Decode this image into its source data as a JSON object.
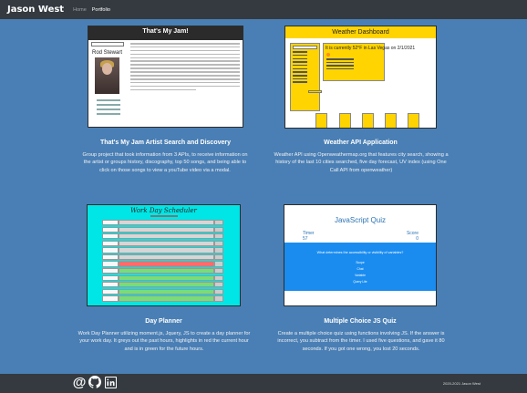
{
  "navbar": {
    "brand": "Jason West",
    "links": [
      "Home",
      "Portfolio"
    ]
  },
  "projects": [
    {
      "title": "That's My Jam Artist Search and Discovery",
      "description": "Group project that took information from 3 APIs, to receive information on the artist or groups history, discography, top 50 songs, and being able to click on those songs to view a youTube video via a modal.",
      "screenshot": {
        "header": "That's My Jam!",
        "artist_name": "Rod Stewart"
      }
    },
    {
      "title": "Weather API Application",
      "description": "Weather API using Openweathermap.org that features city search, showing a history of the last 10 cities searched, five day forecast, UV index (using One Call API from openweather)",
      "screenshot": {
        "header": "Weather Dashboard",
        "current": "It is currently 52°F in Las Vegas on 2/1/2021"
      }
    },
    {
      "title": "Day Planner",
      "description": "Work Day Planner utilizing moment.js, Jquery, JS to create a day planner for your work day. It greys out the past hours, highlights in red the current hour and is in green for the future hours.",
      "screenshot": {
        "header": "Work Day Scheduler"
      }
    },
    {
      "title": "Multiple Choice JS Quiz",
      "description": "Create a multiple choice quiz using functions involving JS. If the answer is incorrect, you subtract from the timer. I used five questions, and gave it 80 seconds. If you got one wrong, you lost 20 seconds.",
      "screenshot": {
        "header": "JavaScript Quiz",
        "timer_label": "Timer",
        "timer_value": "57",
        "score_label": "Score",
        "score_value": "0",
        "question": "What determines the accessibility or visibility of variables?",
        "options": [
          "Scope",
          "Chat",
          "Variable",
          "Query Lite"
        ]
      }
    }
  ],
  "footer": {
    "icons": [
      "at-sign-icon",
      "github-icon",
      "linkedin-icon"
    ],
    "copyright": "2020-2021 Jason West"
  },
  "colors": {
    "background": "#4a7fb5",
    "navbar": "#343a40",
    "weather_accent": "#ffd400",
    "planner_bg": "#00e5e5",
    "quiz_blue": "#1a8cf0"
  }
}
